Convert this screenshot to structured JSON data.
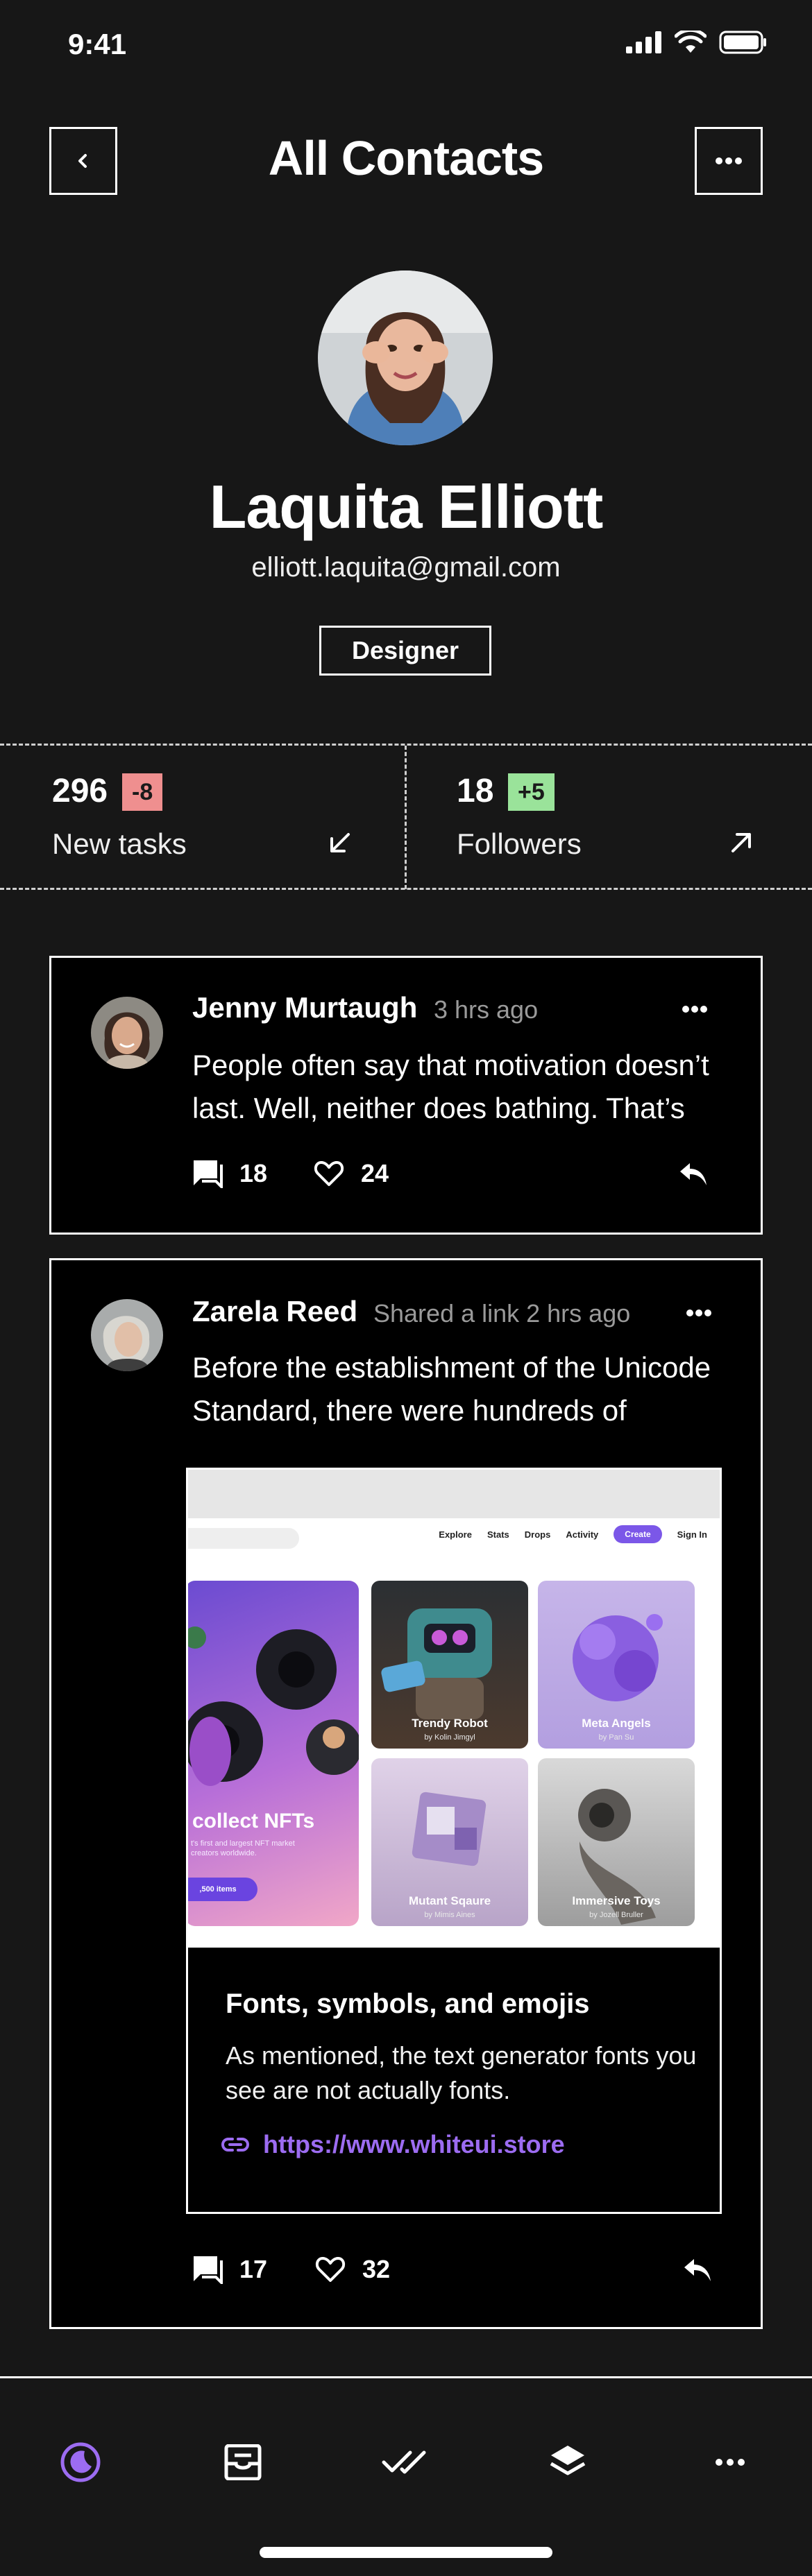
{
  "status_bar": {
    "time": "9:41"
  },
  "header": {
    "title": "All Contacts"
  },
  "profile": {
    "name": "Laquita Elliott",
    "email": "elliott.laquita@gmail.com",
    "role": "Designer"
  },
  "stats": [
    {
      "value": "296",
      "delta": "-8",
      "label": "New tasks",
      "arrow": "arrow-down-left-icon"
    },
    {
      "value": "18",
      "delta": "+5",
      "label": "Followers",
      "arrow": "arrow-up-right-icon"
    }
  ],
  "posts": [
    {
      "author": "Jenny Murtaugh",
      "meta": "3 hrs ago",
      "text": "People often say that motivation doesn’t last. Well, neither does bathing. That’s",
      "comments": "18",
      "likes": "24"
    },
    {
      "author": "Zarela Reed",
      "meta": "Shared a link 2 hrs ago",
      "text": "Before the establishment of the Unicode Standard, there were hundreds of",
      "comments": "17",
      "likes": "32",
      "preview": {
        "site_nav": [
          "Explore",
          "Stats",
          "Drops",
          "Activity",
          "Create",
          "Sign In"
        ],
        "hero_title": "collect NFTs",
        "hero_sub": "t's first and largest NFT market creators worldwide.",
        "hero_btn": ",500 items",
        "tiles": [
          {
            "title": "Trendy Robot",
            "sub": "by Kolin Jimgyl"
          },
          {
            "title": "Meta Angels",
            "sub": "by Pan Su"
          },
          {
            "title": "Mutant Sqaure",
            "sub": "by Mimis Aines"
          },
          {
            "title": "Immersive Toys",
            "sub": "by Jozell Bruller"
          }
        ],
        "title": "Fonts, symbols, and emojis",
        "description": "As mentioned, the text generator fonts you see are not actually fonts.",
        "url": "https://www.whiteui.store"
      }
    }
  ],
  "colors": {
    "accent": "#9c6cf1",
    "negative": "#ef8f8f",
    "positive": "#9ae39a",
    "background": "#171717"
  }
}
